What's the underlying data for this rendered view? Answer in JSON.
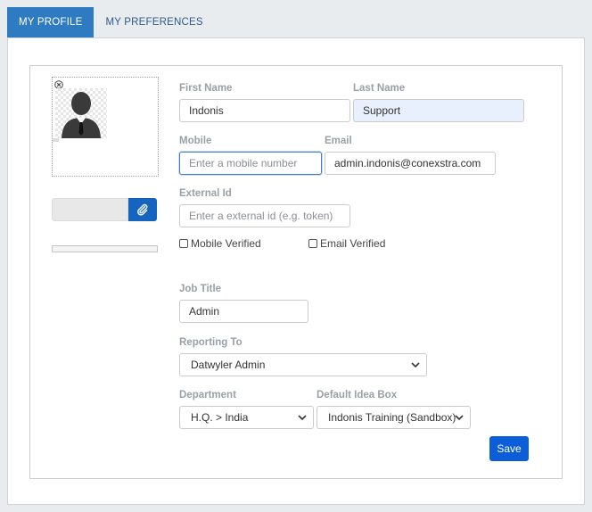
{
  "tabs": [
    {
      "label": "MY PROFILE"
    },
    {
      "label": "MY PREFERENCES"
    }
  ],
  "upload": {
    "progress_percent": 0
  },
  "form": {
    "first_name": {
      "label": "First Name",
      "value": "Indonis"
    },
    "last_name": {
      "label": "Last Name",
      "value": "Support"
    },
    "mobile": {
      "label": "Mobile",
      "value": "",
      "placeholder": "Enter a mobile number"
    },
    "email": {
      "label": "Email",
      "value": "admin.indonis@conexstra.com"
    },
    "external_id": {
      "label": "External Id",
      "value": "",
      "placeholder": "Enter a external id (e.g. token)"
    },
    "mobile_verified": {
      "label": "Mobile Verified",
      "checked": false
    },
    "email_verified": {
      "label": "Email Verified",
      "checked": false
    },
    "job_title": {
      "label": "Job Title",
      "value": "Admin"
    },
    "reporting_to": {
      "label": "Reporting To",
      "selected": "Datwyler Admin"
    },
    "department": {
      "label": "Department",
      "selected": "H.Q. > India"
    },
    "default_idea_box": {
      "label": "Default Idea Box",
      "selected": "Indonis Training (Sandbox)"
    },
    "save_label": "Save"
  },
  "icons": {
    "remove": "close-circle-icon",
    "avatar": "user-silhouette-icon",
    "attach": "paperclip-icon",
    "dropdown": "chevron-down-icon"
  },
  "colors": {
    "tab_active": "#2f7bc1",
    "primary_button": "#0b5ed7",
    "attach_button": "#1565c0",
    "autofill_bg": "#e8f0fe"
  }
}
